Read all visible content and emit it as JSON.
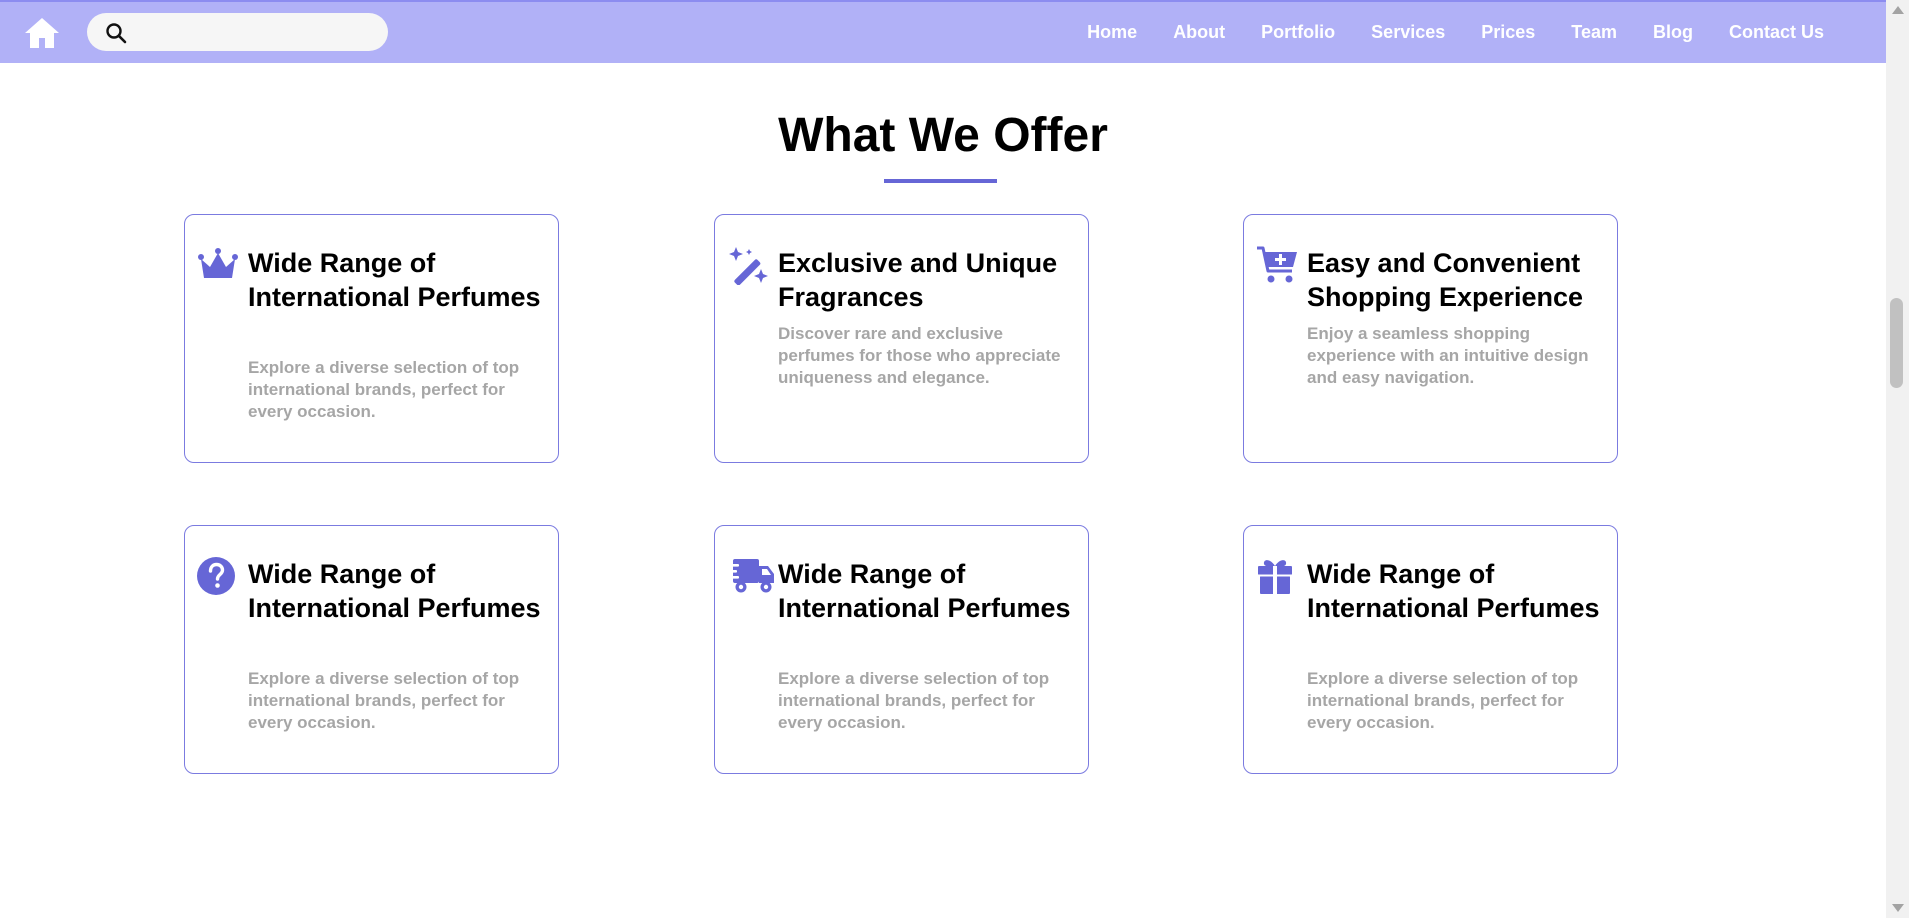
{
  "colors": {
    "navbar_bg": "#b1b1f7",
    "accent": "#6666d6",
    "card_border": "#7b7be0",
    "desc_text": "#a6a6a6"
  },
  "navbar": {
    "home_icon": "home-icon",
    "search": {
      "icon": "search-icon",
      "value": "",
      "placeholder": ""
    },
    "links": [
      "Home",
      "About",
      "Portfolio",
      "Services",
      "Prices",
      "Team",
      "Blog",
      "Contact Us"
    ]
  },
  "section": {
    "title": "What We Offer"
  },
  "cards": [
    {
      "icon": "crown-icon",
      "title": "Wide Range of International Perfumes",
      "description": "Explore a diverse selection of top international brands, perfect for every occasion."
    },
    {
      "icon": "magic-wand-sparkles-icon",
      "title": "Exclusive and Unique Fragrances",
      "description": "Discover rare and exclusive perfumes for those who appreciate uniqueness and elegance."
    },
    {
      "icon": "cart-plus-icon",
      "title": "Easy and Convenient Shopping Experience",
      "description": "Enjoy a seamless shopping experience with an intuitive design and easy navigation."
    },
    {
      "icon": "question-circle-icon",
      "title": "Wide Range of International Perfumes",
      "description": "Explore a diverse selection of top international brands, perfect for every occasion."
    },
    {
      "icon": "fast-truck-icon",
      "title": "Wide Range of International Perfumes",
      "description": "Explore a diverse selection of top international brands, perfect for every occasion."
    },
    {
      "icon": "gift-icon",
      "title": "Wide Range of International Perfumes",
      "description": "Explore a diverse selection of top international brands, perfect for every occasion."
    }
  ]
}
